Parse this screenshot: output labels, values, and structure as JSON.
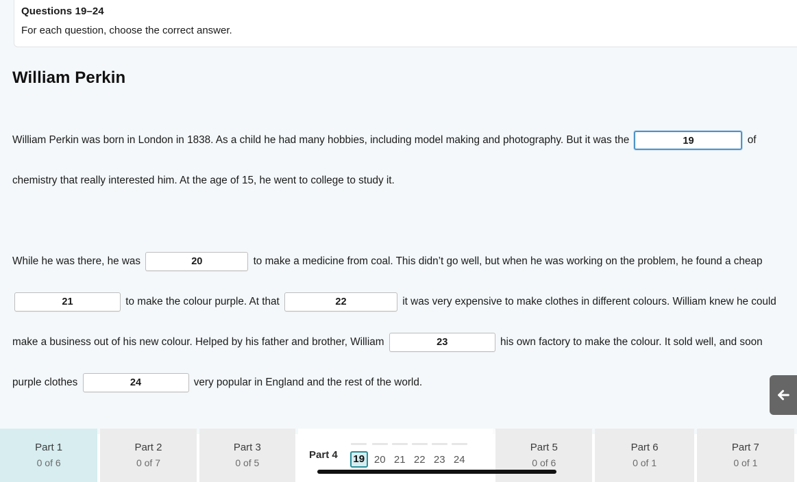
{
  "instruction": {
    "title": "Questions 19–24",
    "subtitle": "For each question, choose the correct answer."
  },
  "passage": {
    "title": "William Perkin",
    "segments": [
      {
        "type": "text",
        "value": "William Perkin was born in London in 1838. As a child he had many hobbies, including model making and photography. But it was the "
      },
      {
        "type": "blank",
        "value": "19",
        "focused": true
      },
      {
        "type": "text",
        "value": " of chemistry that really interested him. At the age of 15, he went to college to study it."
      },
      {
        "type": "break",
        "value": ""
      },
      {
        "type": "text",
        "value": "While he was there, he was "
      },
      {
        "type": "blank",
        "value": "20",
        "focused": false
      },
      {
        "type": "text",
        "value": " to make a medicine from coal. This didn’t go well, but when he was working on the problem, he found a cheap "
      },
      {
        "type": "blank",
        "value": "21",
        "focused": false
      },
      {
        "type": "text",
        "value": " to make the colour purple. At that "
      },
      {
        "type": "blank",
        "value": "22",
        "focused": false
      },
      {
        "type": "text",
        "value": " it was very expensive to make clothes in different colours. William knew he could make a business out of his new colour. Helped by his father and brother, William "
      },
      {
        "type": "blank",
        "value": "23",
        "focused": false
      },
      {
        "type": "text",
        "value": " his own factory to make the colour. It sold well, and soon purple clothes "
      },
      {
        "type": "blank",
        "value": "24",
        "focused": false
      },
      {
        "type": "text",
        "value": " very popular in England and the rest of the world."
      }
    ],
    "blanks": [
      {
        "number": "19",
        "focused": true
      },
      {
        "number": "20",
        "focused": false
      },
      {
        "number": "21",
        "focused": false
      },
      {
        "number": "22",
        "focused": false
      },
      {
        "number": "23",
        "focused": false
      },
      {
        "number": "24",
        "focused": false
      }
    ],
    "paragraph_1_pre": "William Perkin was born in London in 1838. As a child he had many hobbies, including model making and photography. But it was the",
    "paragraph_1_post": "of chemistry that really interested him. At the age of 15, he went to college to study it.",
    "p2_a": "While he was there, he was",
    "p2_b": "to make a medicine from coal. This didn’t go well, but when he was working on the problem, he found a cheap",
    "p2_c": "to make the colour purple. At that",
    "p2_d": "it was very expensive to make clothes in different colours. William knew he could make a business out of his new colour. Helped by his father and brother, William",
    "p2_e": "his own factory to make the colour. It sold well, and soon purple clothes",
    "p2_f": "very popular in England and the rest of the world."
  },
  "side_toggle": {
    "icon": "arrow-left-icon",
    "color": "#666666"
  },
  "tabbar": {
    "tabs": [
      {
        "title": "Part 1",
        "count": "0 of 6",
        "state": "completed-highlight"
      },
      {
        "title": "Part 2",
        "count": "0 of 7",
        "state": "default"
      },
      {
        "title": "Part 3",
        "count": "0 of 5",
        "state": "default"
      },
      {
        "title": "Part 4",
        "count": "",
        "state": "active"
      },
      {
        "title": "Part 5",
        "count": "0 of 6",
        "state": "default"
      },
      {
        "title": "Part 6",
        "count": "0 of 1",
        "state": "default"
      },
      {
        "title": "Part 7",
        "count": "0 of 1",
        "state": "default"
      }
    ],
    "active_tab_title": "Part 4",
    "question_numbers": [
      "19",
      "20",
      "21",
      "22",
      "23",
      "24"
    ],
    "current_question": "19"
  },
  "colors": {
    "page_background": "#f4f8fa",
    "card_background": "#ffffff",
    "tab_default": "#ececec",
    "tab_highlight": "#d7edf0",
    "accent_teal": "#2a8f99",
    "focus_blue": "#4e93c8",
    "progress_bar": "#111111",
    "toggle_gray": "#666666"
  }
}
